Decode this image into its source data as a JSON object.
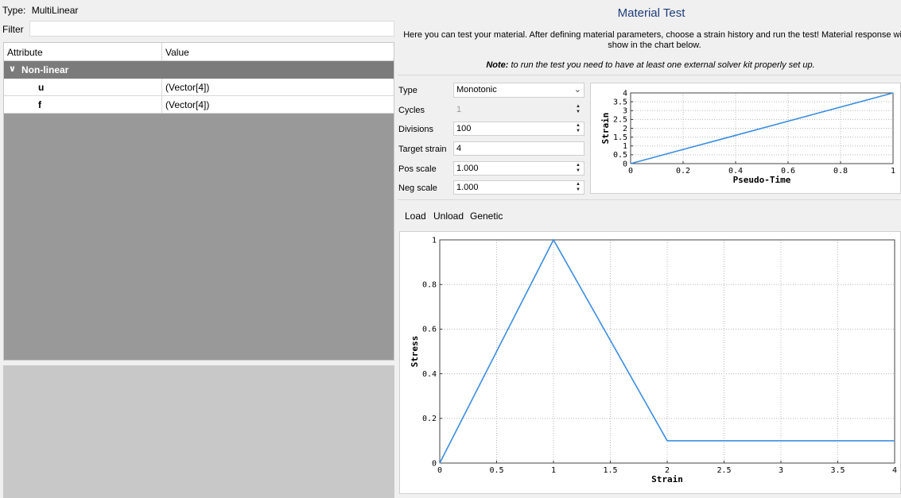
{
  "left": {
    "type_label": "Type:",
    "type_value": "MultiLinear",
    "filter_label": "Filter",
    "filter_value": "",
    "table": {
      "col_attribute": "Attribute",
      "col_value": "Value",
      "group": "Non-linear",
      "rows": [
        {
          "name": "u",
          "value": "(Vector[4])"
        },
        {
          "name": "f",
          "value": "(Vector[4])"
        }
      ]
    }
  },
  "right": {
    "title": "Material Test",
    "description_line1": "Here you can test your material. After defining material parameters, choose a strain history and run the test! Material response will",
    "description_line2": "show in the chart below.",
    "note_bold": "Note:",
    "note_text": " to run the test you need to have at least one external solver kit properly set up.",
    "params": {
      "type_label": "Type",
      "type_value": "Monotonic",
      "cycles_label": "Cycles",
      "cycles_value": "1",
      "divisions_label": "Divisions",
      "divisions_value": "100",
      "target_label": "Target strain",
      "target_value": "4",
      "pos_label": "Pos scale",
      "pos_value": "1.000",
      "neg_label": "Neg scale",
      "neg_value": "1.000"
    },
    "toolbar": {
      "load": "Load",
      "unload": "Unload",
      "genetic": "Genetic"
    }
  },
  "colors": {
    "line": "#3b8de0",
    "accent_title": "#1f3e7a"
  },
  "chart_data": [
    {
      "type": "line",
      "xlabel": "Pseudo-Time",
      "ylabel": "Strain",
      "xlim": [
        0,
        1
      ],
      "ylim": [
        0,
        4
      ],
      "xticks": [
        "0",
        "0.2",
        "0.4",
        "0.6",
        "0.8",
        "1"
      ],
      "yticks": [
        "0",
        "0.5",
        "1",
        "1.5",
        "2",
        "2.5",
        "3",
        "3.5",
        "4"
      ],
      "grid": true,
      "series": [
        {
          "x": [
            0,
            1
          ],
          "y": [
            0,
            4
          ]
        }
      ]
    },
    {
      "type": "line",
      "xlabel": "Strain",
      "ylabel": "Stress",
      "xlim": [
        0,
        4
      ],
      "ylim": [
        0,
        1
      ],
      "xticks": [
        "0",
        "0.5",
        "1",
        "1.5",
        "2",
        "2.5",
        "3",
        "3.5",
        "4"
      ],
      "yticks": [
        "0",
        "0.2",
        "0.4",
        "0.6",
        "0.8",
        "1"
      ],
      "grid": true,
      "series": [
        {
          "x": [
            0,
            1,
            2,
            4
          ],
          "y": [
            0,
            1,
            0.1,
            0.1
          ]
        }
      ]
    }
  ]
}
